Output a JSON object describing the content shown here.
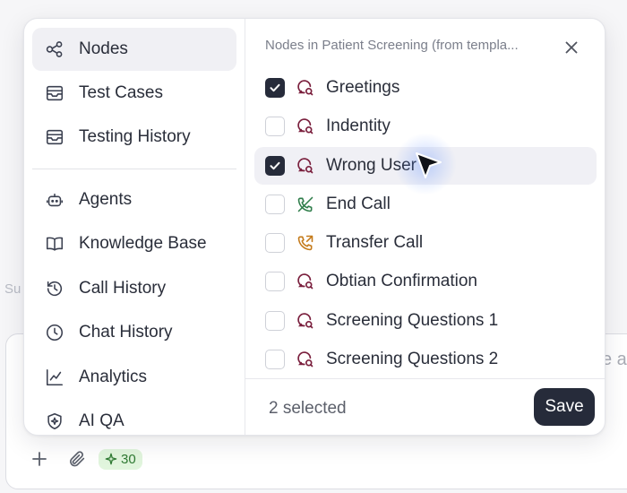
{
  "background": {
    "left_fragment": "Su",
    "right_fragment": "e a",
    "toolbar": {
      "add_icon": "plus-icon",
      "attach_icon": "paperclip-icon",
      "credits": "30"
    }
  },
  "sidebar": {
    "items": [
      {
        "label": "Nodes",
        "icon": "nodes-icon",
        "active": true
      },
      {
        "label": "Test Cases",
        "icon": "inbox-icon"
      },
      {
        "label": "Testing History",
        "icon": "inbox-icon"
      },
      {
        "label": "Agents",
        "icon": "robot-icon"
      },
      {
        "label": "Knowledge Base",
        "icon": "book-icon"
      },
      {
        "label": "Call History",
        "icon": "history-icon"
      },
      {
        "label": "Chat History",
        "icon": "clock-icon"
      },
      {
        "label": "Analytics",
        "icon": "chart-line-icon"
      },
      {
        "label": "AI QA",
        "icon": "sparkle-shield-icon"
      }
    ]
  },
  "panel": {
    "header": "Nodes in Patient Screening (from templa...",
    "nodes": [
      {
        "label": "Greetings",
        "checked": true,
        "icon": "chat-node-icon"
      },
      {
        "label": "Indentity",
        "checked": false,
        "icon": "chat-node-icon"
      },
      {
        "label": "Wrong User",
        "checked": true,
        "icon": "chat-node-icon"
      },
      {
        "label": "End Call",
        "checked": false,
        "icon": "phone-off-icon"
      },
      {
        "label": "Transfer Call",
        "checked": false,
        "icon": "phone-forward-icon"
      },
      {
        "label": "Obtian Confirmation",
        "checked": false,
        "icon": "chat-node-icon"
      },
      {
        "label": "Screening Questions 1",
        "checked": false,
        "icon": "chat-node-icon"
      },
      {
        "label": "Screening Questions 2",
        "checked": false,
        "icon": "chat-node-icon"
      }
    ],
    "selected_count": "2 selected",
    "save_label": "Save"
  },
  "colors": {
    "primary_dark": "#262b3a",
    "chat_node_icon": "#7a1f3d",
    "end_call_icon": "#2e7d4a",
    "transfer_call_icon": "#c47a1a",
    "credits_bg": "#e1f5dd",
    "credits_fg": "#2f7a33"
  }
}
